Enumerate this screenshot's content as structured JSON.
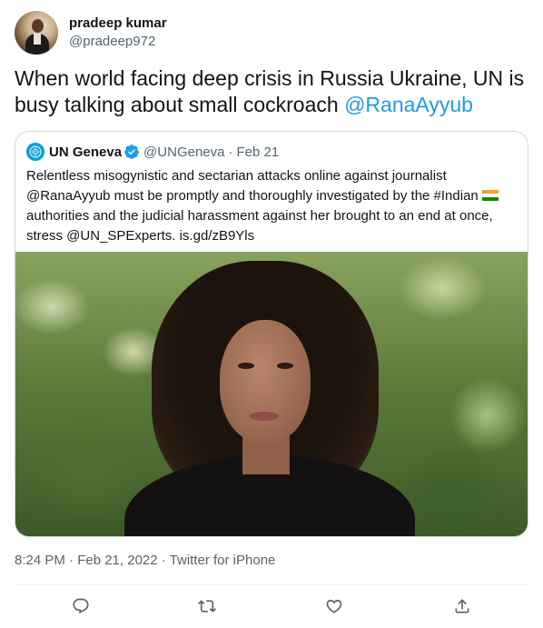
{
  "author": {
    "display_name": "pradeep kumar",
    "handle": "@pradeep972"
  },
  "tweet": {
    "text": "When world facing deep crisis in Russia Ukraine, UN is busy talking about small cockroach ",
    "mention": "@RanaAyyub"
  },
  "quoted_tweet": {
    "display_name": "UN Geneva",
    "handle": "@UNGeneva",
    "separator": "·",
    "date": "Feb 21",
    "text_part1": "Relentless misogynistic and sectarian attacks online against journalist @RanaAyyub  must be promptly and thoroughly investigated by the #Indian",
    "text_part2": "authorities and the judicial harassment against her brought to an end at once, stress @UN_SPExperts. is.gd/zB9Yls",
    "flag_colors": [
      "#ff9933",
      "#ffffff",
      "#138808"
    ]
  },
  "meta": {
    "text": "8:24 PM · Feb 21, 2022 · Twitter for iPhone"
  },
  "actions": {
    "reply_icon": "reply-icon",
    "retweet_icon": "retweet-icon",
    "like_icon": "like-icon",
    "share_icon": "share-icon"
  },
  "colors": {
    "accent": "#1d9bf0",
    "muted": "#536471",
    "text": "#0f1419",
    "border": "#cfd9de"
  }
}
